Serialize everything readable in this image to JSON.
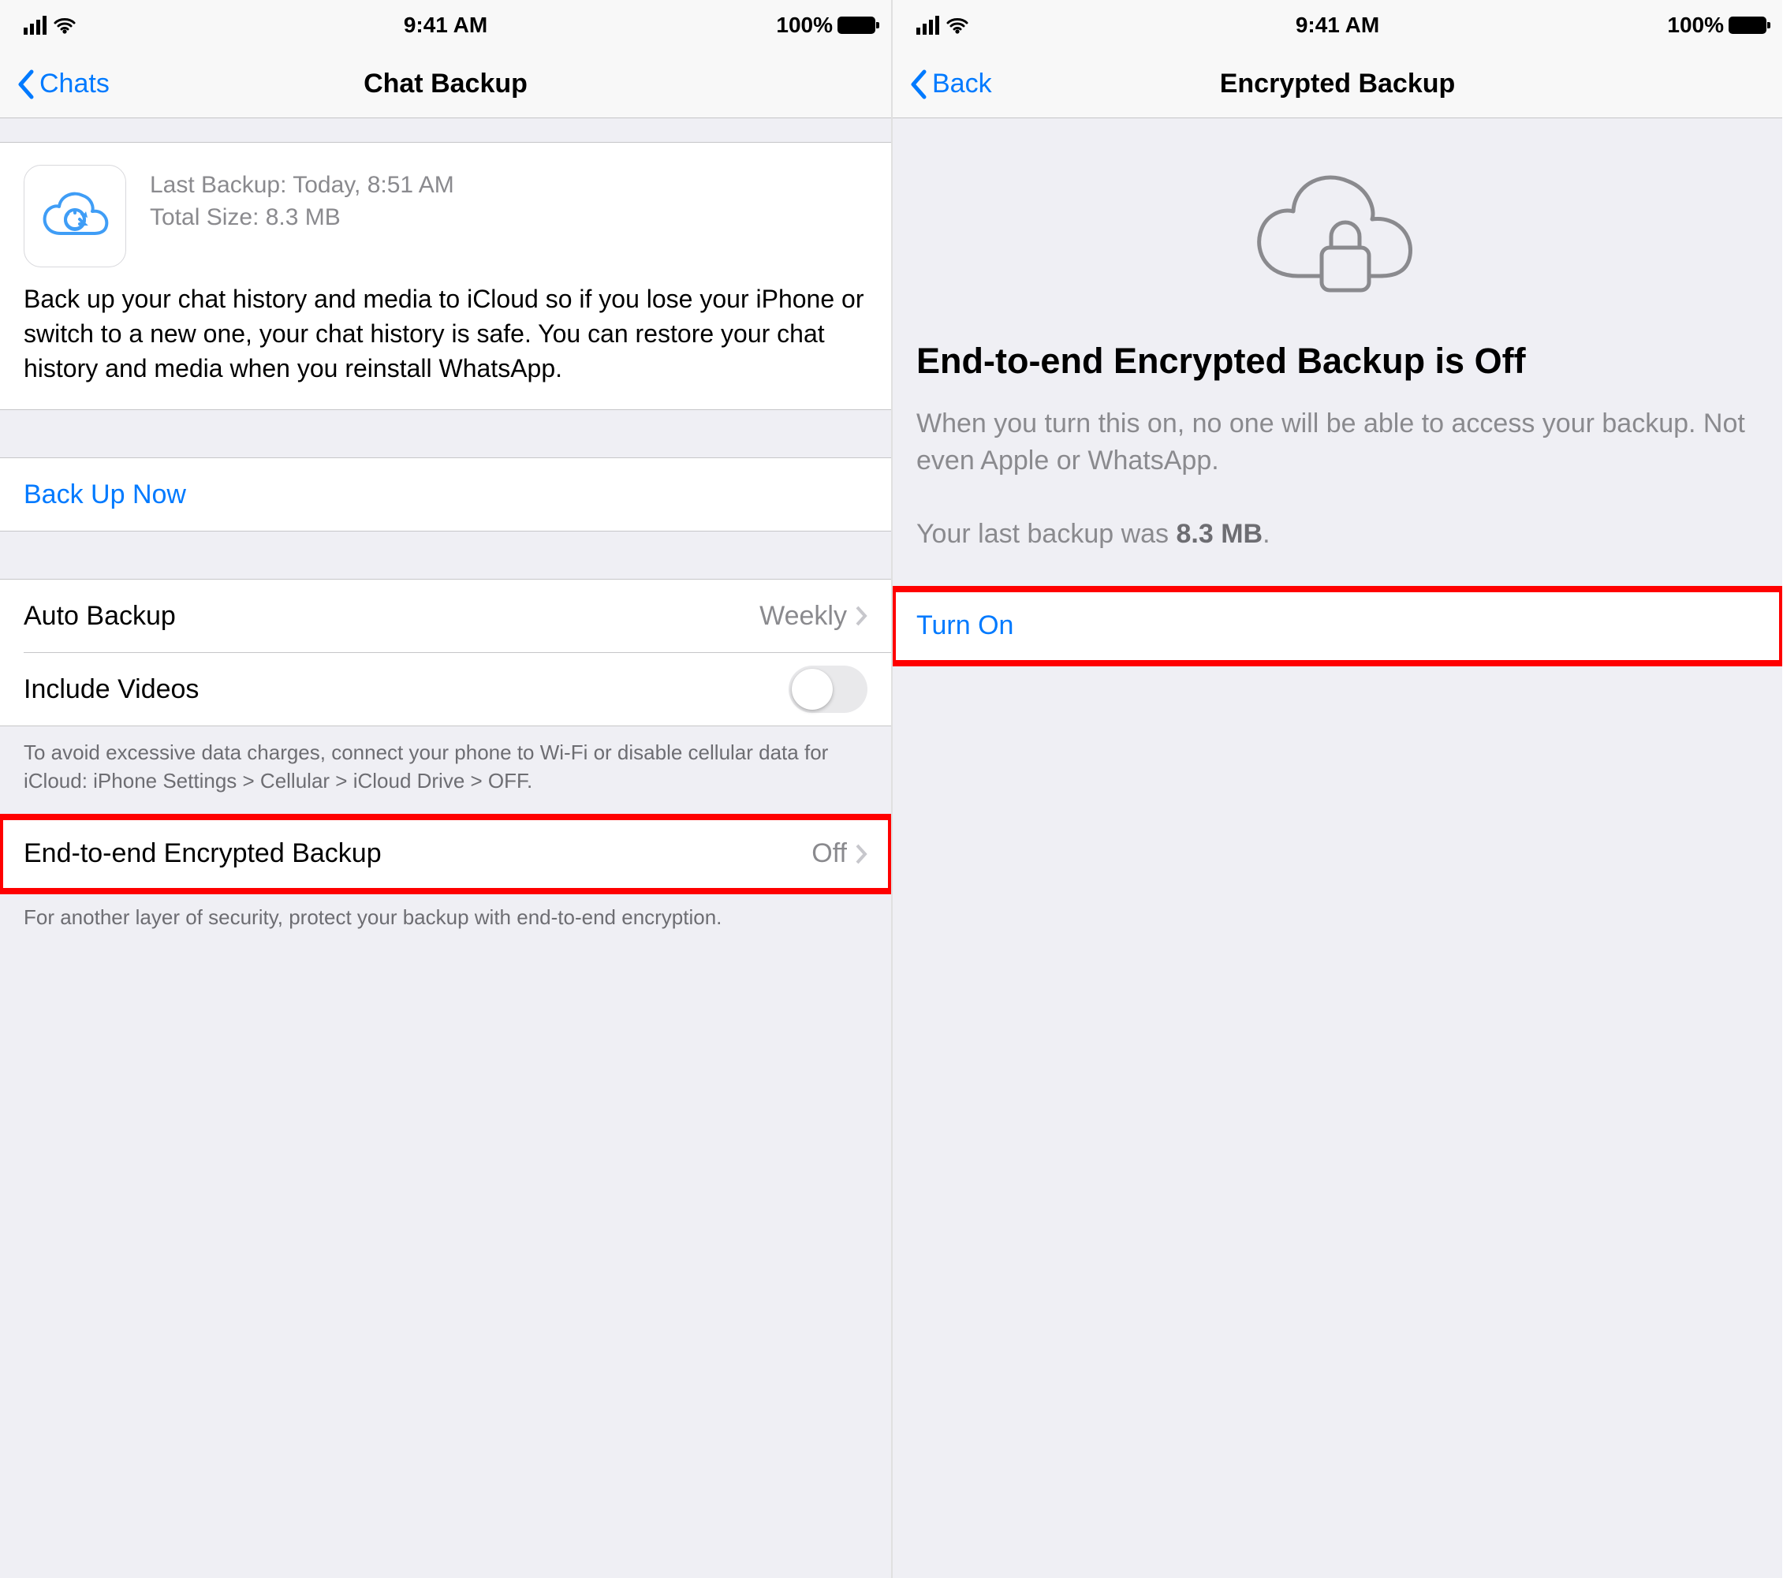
{
  "status": {
    "time": "9:41 AM",
    "battery": "100%"
  },
  "left": {
    "backLabel": "Chats",
    "title": "Chat Backup",
    "lastBackupLabel": "Last Backup:",
    "lastBackupValue": "Today, 8:51 AM",
    "totalSizeLabel": "Total Size:",
    "totalSizeValue": "8.3 MB",
    "description": "Back up your chat history and media to iCloud so if you lose your iPhone or switch to a new one, your chat history is safe. You can restore your chat history and media when you reinstall WhatsApp.",
    "backUpNow": "Back Up Now",
    "autoBackupLabel": "Auto Backup",
    "autoBackupValue": "Weekly",
    "includeVideosLabel": "Include Videos",
    "dataNote": "To avoid excessive data charges, connect your phone to Wi-Fi or disable cellular data for iCloud: iPhone Settings > Cellular > iCloud Drive > OFF.",
    "e2eLabel": "End-to-end Encrypted Backup",
    "e2eValue": "Off",
    "e2eNote": "For another layer of security, protect your backup with end-to-end encryption."
  },
  "right": {
    "backLabel": "Back",
    "title": "Encrypted Backup",
    "heroTitle": "End-to-end Encrypted Backup is Off",
    "heroDesc": "When you turn this on, no one will be able to access your backup. Not even Apple or WhatsApp.",
    "lastBackupPrefix": "Your last backup was ",
    "lastBackupSize": "8.3 MB",
    "lastBackupSuffix": ".",
    "turnOn": "Turn On"
  }
}
